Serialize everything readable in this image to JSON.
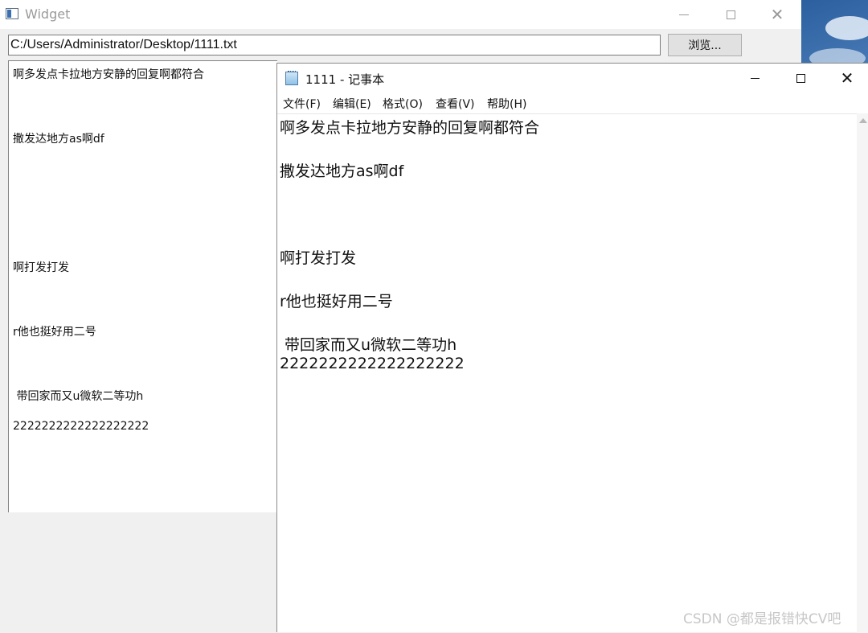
{
  "widget": {
    "title": "Widget",
    "path_value": "C:/Users/Administrator/Desktop/1111.txt",
    "browse_label": "浏览...",
    "text_lines": [
      "啊多发点卡拉地方安静的回复啊都符合",
      "撒发达地方as啊df",
      "啊打发打发",
      "r他也挺好用二号",
      " 带回家而又u微软二等功h",
      "2222222222222222222"
    ]
  },
  "notepad": {
    "title": "1111 - 记事本",
    "menu": [
      "文件(F)",
      "编辑(E)",
      "格式(O)",
      "查看(V)",
      "帮助(H)"
    ],
    "text_lines": [
      "啊多发点卡拉地方安静的回复啊都符合",
      "撒发达地方as啊df",
      "啊打发打发",
      "r他也挺好用二号",
      " 带回家而又u微软二等功h",
      "2222222222222222222"
    ]
  },
  "window_controls": {
    "minimize": "minimize",
    "maximize": "maximize",
    "close": "close"
  },
  "watermark": "CSDN @都是报错快CV吧",
  "colors": {
    "accent": "#0078d7",
    "title_inactive": "#9a9a9a"
  }
}
